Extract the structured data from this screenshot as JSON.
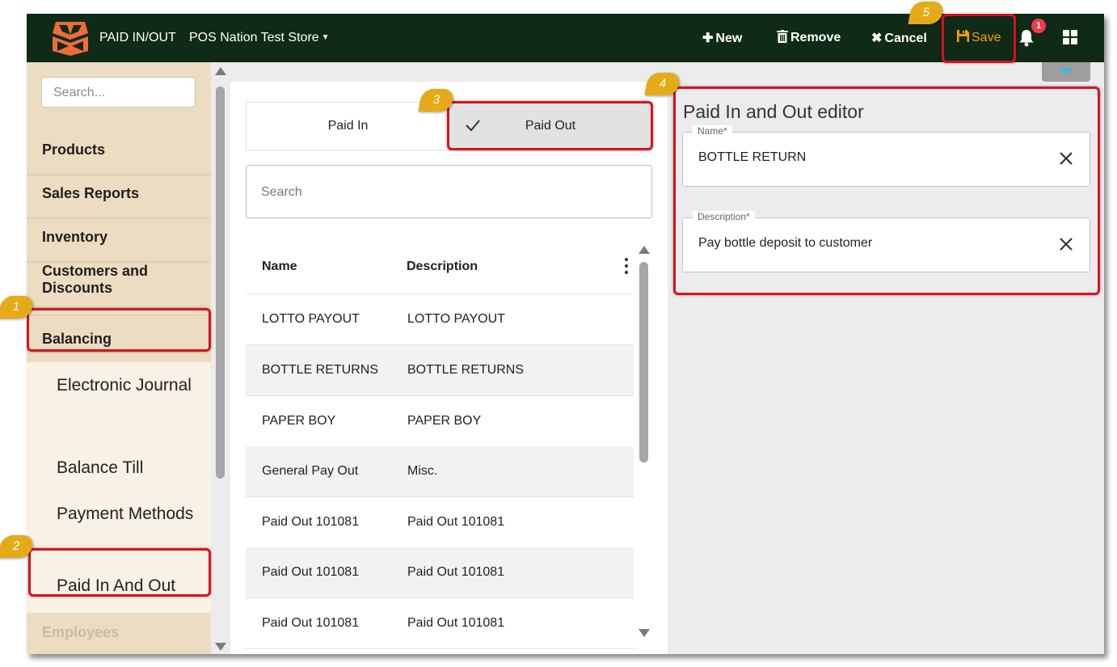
{
  "topbar": {
    "app_title": "PAID IN/OUT",
    "store_name": "POS Nation Test Store",
    "buttons": {
      "new": "New",
      "remove": "Remove",
      "cancel": "Cancel",
      "save": "Save"
    },
    "notification_count": "1",
    "icons": [
      "logo-icon",
      "plus-icon",
      "trash-icon",
      "x-icon",
      "floppy-disk-icon",
      "bell-icon",
      "grid-icon"
    ],
    "save_color": "#f5a000"
  },
  "sidebar": {
    "search_placeholder": "Search...",
    "items": [
      {
        "label": "Products"
      },
      {
        "label": "Sales Reports"
      },
      {
        "label": "Inventory"
      },
      {
        "label": "Customers and Discounts"
      },
      {
        "label": "Balancing"
      }
    ],
    "sub_items": [
      {
        "label": "Electronic Journal"
      },
      {
        "label": "Balance Till"
      },
      {
        "label": "Payment Methods"
      },
      {
        "label": "Paid In And Out"
      }
    ],
    "faded_item": "Employees"
  },
  "list_panel": {
    "toggle": {
      "paid_in": "Paid In",
      "paid_out": "Paid Out",
      "selected": "Paid Out"
    },
    "search_placeholder": "Search",
    "columns": {
      "name": "Name",
      "description": "Description"
    },
    "rows": [
      {
        "name": "LOTTO PAYOUT",
        "description": "LOTTO PAYOUT"
      },
      {
        "name": "BOTTLE RETURNS",
        "description": "BOTTLE RETURNS"
      },
      {
        "name": "PAPER BOY",
        "description": "PAPER BOY"
      },
      {
        "name": "General Pay Out",
        "description": "Misc."
      },
      {
        "name": "Paid Out 101081",
        "description": "Paid Out 101081"
      },
      {
        "name": "Paid Out 101081",
        "description": "Paid Out 101081"
      },
      {
        "name": "Paid Out 101081",
        "description": "Paid Out 101081"
      }
    ]
  },
  "editor": {
    "title": "Paid In and Out editor",
    "name_label": "Name*",
    "name_value": "BOTTLE RETURN",
    "description_label": "Description*",
    "description_value": "Pay bottle deposit to customer"
  },
  "annotations": [
    "1",
    "2",
    "3",
    "4",
    "5"
  ],
  "colors": {
    "topbar_bg": "#0f2a16",
    "sidebar_bg": "#ecdcc1",
    "highlight": "#d6131f",
    "callout": "#e5aa18",
    "badge": "#ef3b4b"
  }
}
